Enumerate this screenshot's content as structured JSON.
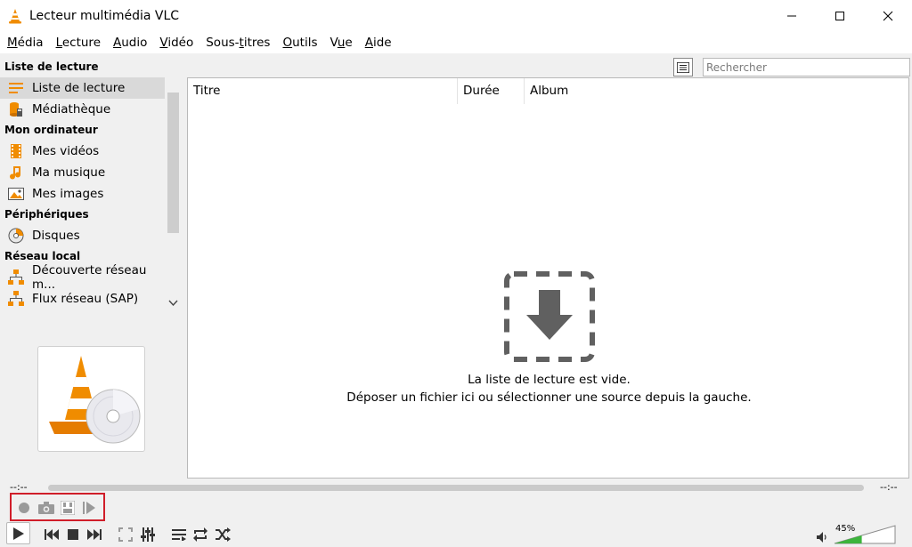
{
  "window": {
    "title": "Lecteur multimédia VLC"
  },
  "menu": [
    {
      "pre": "",
      "ul": "M",
      "post": "édia"
    },
    {
      "pre": "",
      "ul": "L",
      "post": "ecture"
    },
    {
      "pre": "",
      "ul": "A",
      "post": "udio"
    },
    {
      "pre": "",
      "ul": "V",
      "post": "idéo"
    },
    {
      "pre": "Sous-",
      "ul": "t",
      "post": "itres"
    },
    {
      "pre": "",
      "ul": "O",
      "post": "utils"
    },
    {
      "pre": "V",
      "ul": "u",
      "post": "e"
    },
    {
      "pre": "",
      "ul": "A",
      "post": "ide"
    }
  ],
  "sidebar": {
    "sections": [
      {
        "header": "Liste de lecture",
        "items": [
          {
            "label": "Liste de lecture",
            "icon": "playlist-icon",
            "selected": true
          },
          {
            "label": "Médiathèque",
            "icon": "library-icon"
          }
        ]
      },
      {
        "header": "Mon ordinateur",
        "items": [
          {
            "label": "Mes vidéos",
            "icon": "film-icon"
          },
          {
            "label": "Ma musique",
            "icon": "music-note-icon"
          },
          {
            "label": "Mes images",
            "icon": "picture-icon"
          }
        ]
      },
      {
        "header": "Périphériques",
        "items": [
          {
            "label": "Disques",
            "icon": "disc-icon"
          }
        ]
      },
      {
        "header": "Réseau local",
        "items": [
          {
            "label": "Découverte réseau m...",
            "icon": "network-icon"
          },
          {
            "label": "Flux réseau (SAP)",
            "icon": "network-icon"
          }
        ]
      }
    ]
  },
  "search": {
    "placeholder": "Rechercher"
  },
  "playlist": {
    "columns": [
      "Titre",
      "Durée",
      "Album"
    ],
    "empty_line1": "La liste de lecture est vide.",
    "empty_line2": "Déposer un fichier ici ou sélectionner une source depuis la gauche."
  },
  "seek": {
    "elapsed": "--:--",
    "remaining": "--:--"
  },
  "volume": {
    "percent": "45%",
    "level": 0.45
  },
  "colors": {
    "accent_orange": "#f08c00",
    "highlight_red": "#d01e2a",
    "volume_green": "#3cb43c"
  }
}
